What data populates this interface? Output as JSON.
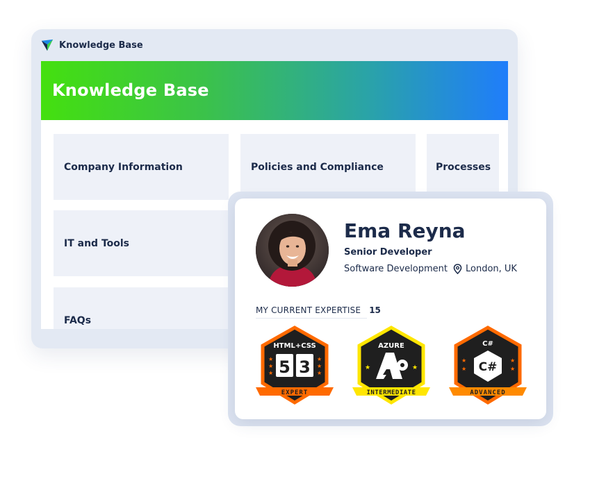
{
  "knowledge_base": {
    "app_title": "Knowledge Base",
    "banner_title": "Knowledge Base",
    "categories": [
      "Company Information",
      "Policies and Compliance",
      "Processes",
      "IT and Tools",
      "FAQs"
    ]
  },
  "profile": {
    "name": "Ema Reyna",
    "role": "Senior Developer",
    "department": "Software Development",
    "location": "London, UK",
    "expertise_label": "MY CURRENT EXPERTISE",
    "expertise_count": "15",
    "badges": [
      {
        "top": "HTML+CSS",
        "ribbon": "EXPERT",
        "icon": "html-css-icon",
        "border": "#ff6a00",
        "ribbon_color": "#ff6a00"
      },
      {
        "top": "AZURE",
        "ribbon": "INTERMEDIATE",
        "icon": "azure-icon",
        "border": "#ffe600",
        "ribbon_color": "#ffe600"
      },
      {
        "top": "C#",
        "ribbon": "ADVANCED",
        "icon": "csharp-icon",
        "border": "#ff6a00",
        "ribbon_color": "#ff8a00"
      }
    ]
  },
  "colors": {
    "navy": "#1c2b4a",
    "gradient_start": "#44e00f",
    "gradient_end": "#1f7dfb",
    "card_bg": "#eef1f8",
    "frame_bg": "#e3e9f3"
  }
}
